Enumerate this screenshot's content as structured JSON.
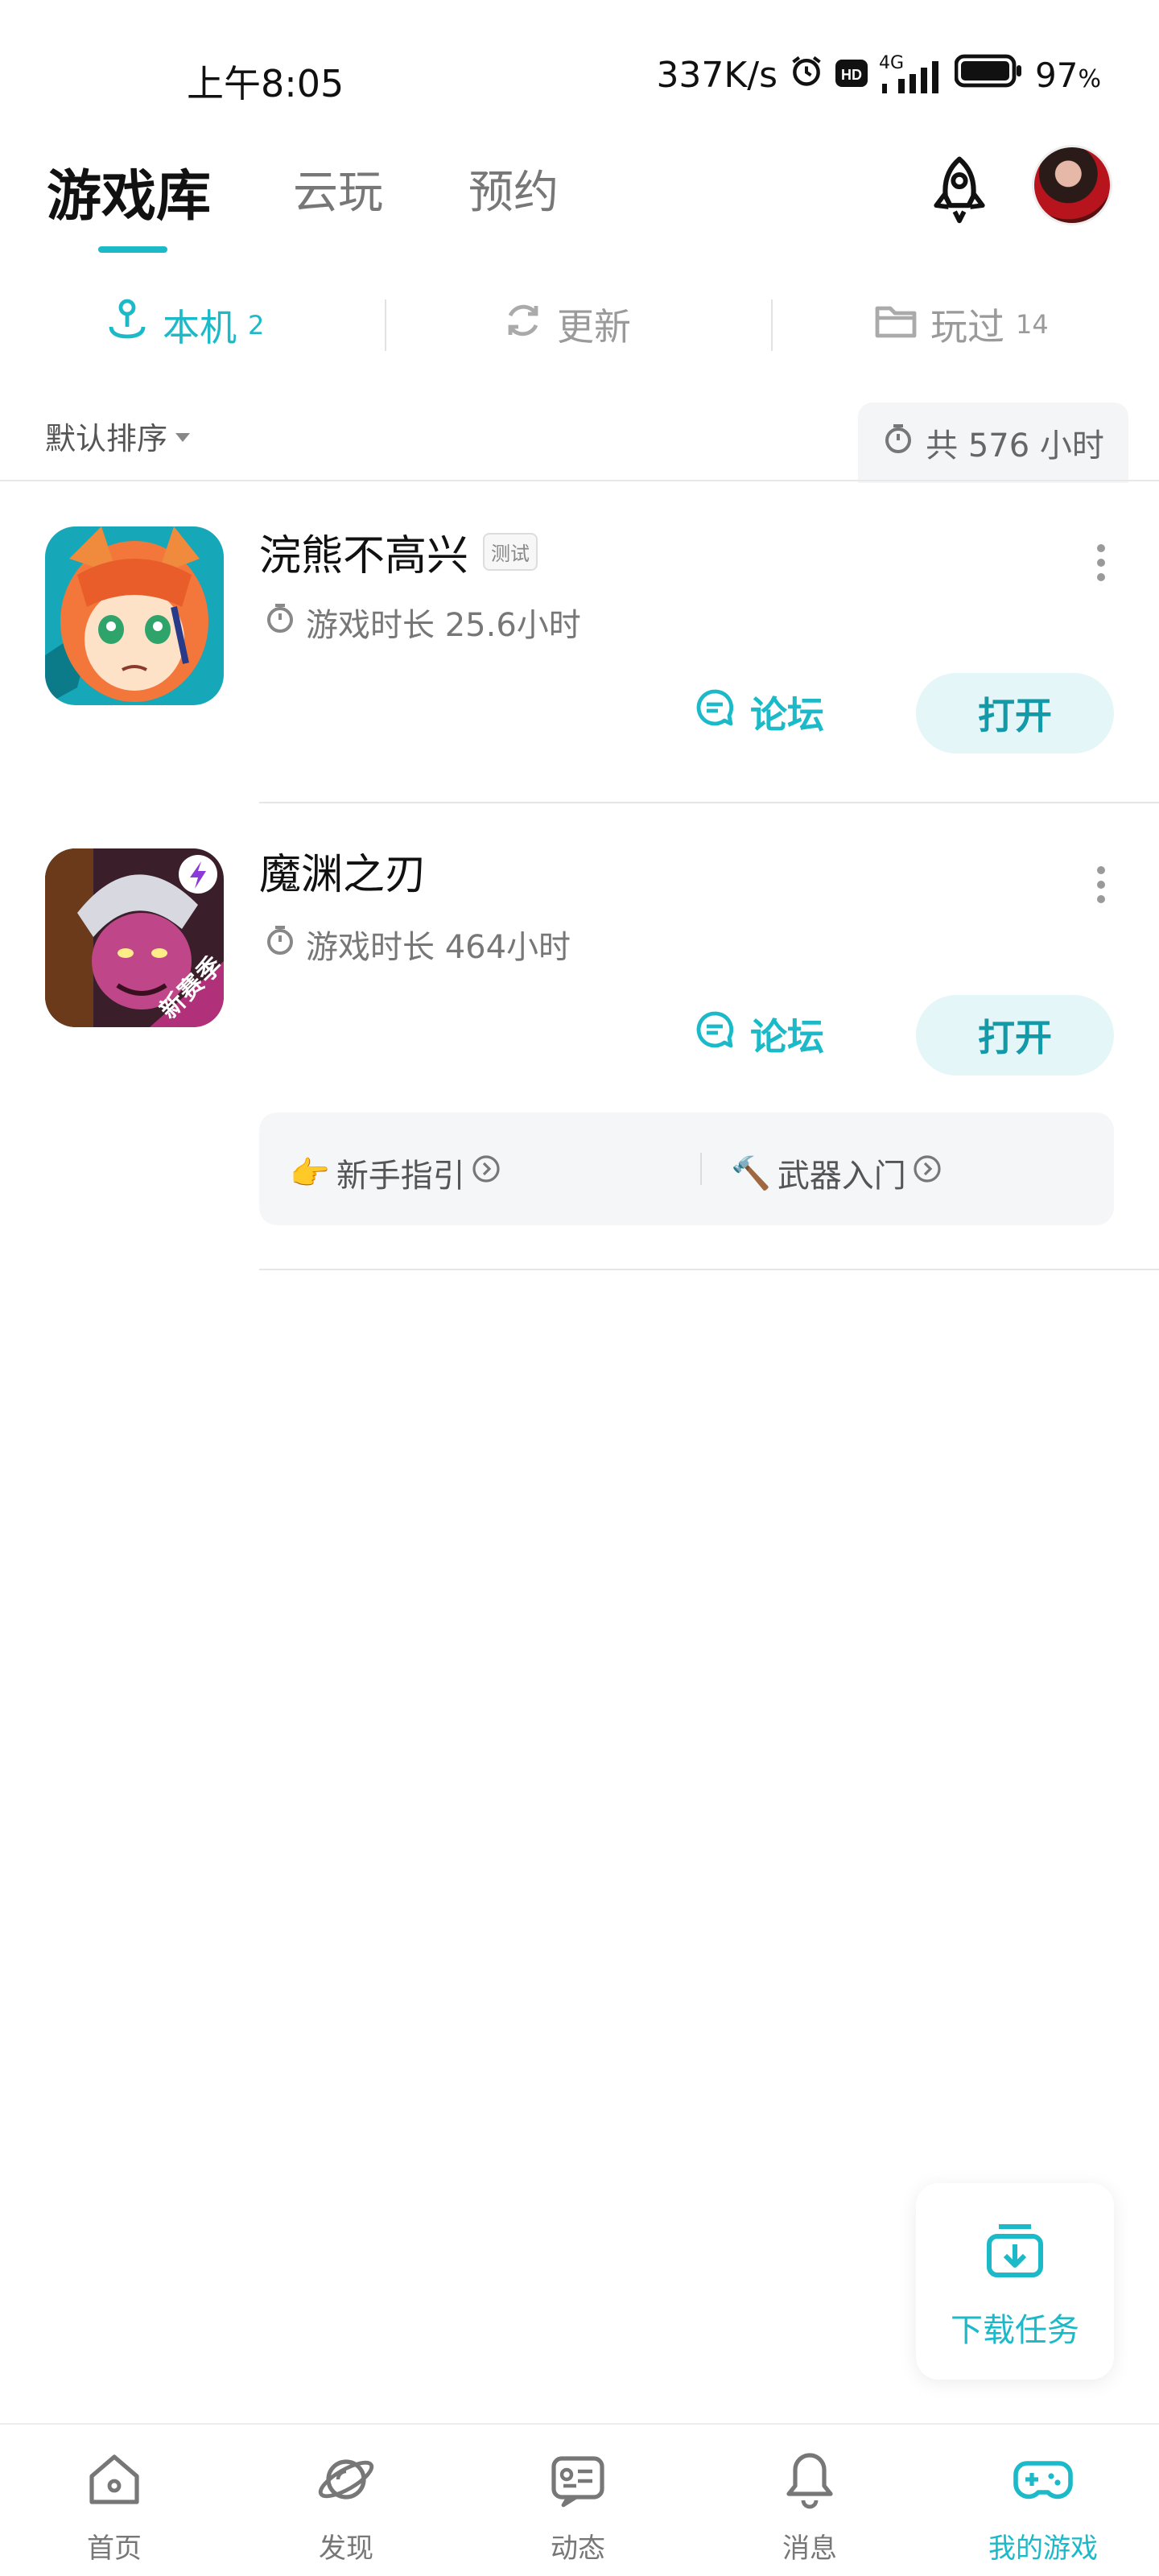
{
  "status_bar": {
    "time": "上午8:05",
    "speed": "337K/s",
    "network": "4G",
    "battery": "97",
    "battery_unit": "%"
  },
  "header": {
    "tabs": [
      {
        "label": "游戏库",
        "active": true
      },
      {
        "label": "云玩",
        "active": false
      },
      {
        "label": "预约",
        "active": false
      }
    ]
  },
  "subtabs": [
    {
      "label": "本机",
      "count": "2",
      "icon": "joystick-icon",
      "active": true
    },
    {
      "label": "更新",
      "count": "",
      "icon": "refresh-icon",
      "active": false
    },
    {
      "label": "玩过",
      "count": "14",
      "icon": "folder-icon",
      "active": false
    }
  ],
  "sort": {
    "label": "默认排序",
    "total": "共 576 小时"
  },
  "games": [
    {
      "name": "浣熊不高兴",
      "badge": "测试",
      "play_time": "游戏时长 25.6小时",
      "forum_label": "论坛",
      "open_label": "打开"
    },
    {
      "name": "魔渊之刃",
      "icon_tag": "新赛季",
      "play_time": "游戏时长 464小时",
      "forum_label": "论坛",
      "open_label": "打开",
      "guides": [
        {
          "emoji": "👉",
          "label": "新手指引"
        },
        {
          "emoji": "🔨",
          "label": "武器入门"
        }
      ]
    }
  ],
  "download_task": {
    "label": "下载任务"
  },
  "bottom_nav": [
    {
      "label": "首页",
      "icon": "home-icon",
      "active": false
    },
    {
      "label": "发现",
      "icon": "planet-icon",
      "active": false
    },
    {
      "label": "动态",
      "icon": "feed-icon",
      "active": false
    },
    {
      "label": "消息",
      "icon": "bell-icon",
      "active": false
    },
    {
      "label": "我的游戏",
      "icon": "gamepad-icon",
      "active": true
    }
  ],
  "colors": {
    "accent": "#1cb9c8",
    "open_button_bg": "#e4f6f7",
    "text_primary": "#111111",
    "text_secondary": "#777777"
  }
}
